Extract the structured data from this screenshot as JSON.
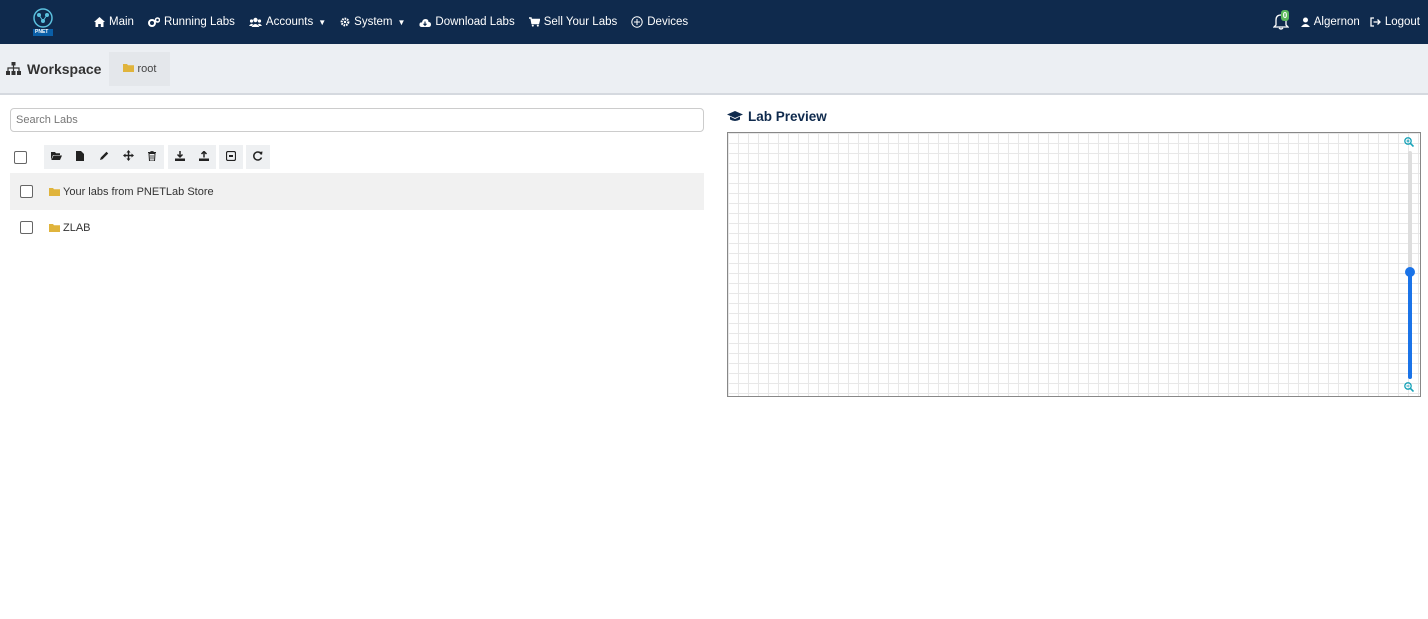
{
  "nav": {
    "logo_text": "PNET",
    "items": [
      {
        "label": "Main",
        "icon": "home-icon",
        "caret": false
      },
      {
        "label": "Running Labs",
        "icon": "cogs-icon",
        "caret": false
      },
      {
        "label": "Accounts",
        "icon": "users-icon",
        "caret": true
      },
      {
        "label": "System",
        "icon": "gear-icon",
        "caret": true
      },
      {
        "label": "Download Labs",
        "icon": "cloud-download-icon",
        "caret": false
      },
      {
        "label": "Sell Your Labs",
        "icon": "cart-icon",
        "caret": false
      },
      {
        "label": "Devices",
        "icon": "plus-circle-icon",
        "caret": false
      }
    ],
    "notification_count": "0",
    "user_label": "Algernon",
    "logout_label": "Logout"
  },
  "workspace": {
    "title": "Workspace",
    "breadcrumb": "root"
  },
  "search": {
    "placeholder": "Search Labs",
    "value": ""
  },
  "toolbar": {
    "buttons": [
      "open-folder-icon",
      "new-file-icon",
      "edit-icon",
      "move-icon",
      "delete-icon",
      "import-icon",
      "export-icon",
      "import-folder-icon",
      "refresh-icon"
    ]
  },
  "labs": [
    {
      "name": "Your labs from PNETLab Store",
      "type": "folder"
    },
    {
      "name": "ZLAB",
      "type": "folder"
    }
  ],
  "preview": {
    "title": "Lab Preview",
    "zoom_level_fraction": 0.47
  },
  "colors": {
    "navbar": "#0f2a4d",
    "folder": "#e0b43c",
    "accent": "#1a73e8"
  }
}
